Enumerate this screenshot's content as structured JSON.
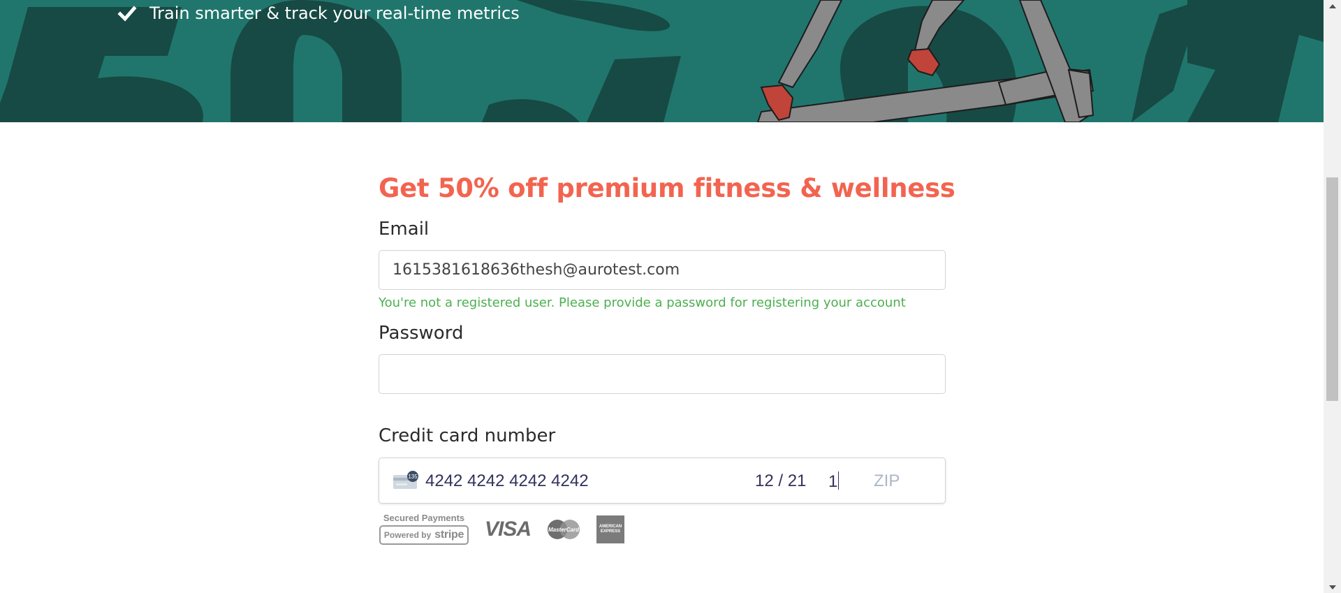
{
  "hero": {
    "bullet_text": "Train smarter & track your real-time metrics",
    "background_color": "#20766d",
    "big_text_color": "#174a44"
  },
  "form": {
    "title": "Get 50% off premium fitness & wellness",
    "title_color": "#f26450",
    "email_label": "Email",
    "email_value": "1615381618636thesh@aurotest.com",
    "email_hint": "You're not a registered user. Please provide a password for registering your account",
    "hint_color": "#4caf50",
    "password_label": "Password",
    "password_value": "",
    "card_label": "Credit card number",
    "card": {
      "number": "4242 4242 4242 4242",
      "expiry": "12 / 21",
      "cvc": "1",
      "zip_placeholder": "ZIP",
      "cvc_icon_text": "135"
    }
  },
  "payment_logos": {
    "secured": "Secured Payments",
    "powered_by": "Powered by",
    "stripe": "stripe",
    "visa": "VISA",
    "mastercard": "MasterCard",
    "amex": "AMERICAN EXPRESS"
  }
}
